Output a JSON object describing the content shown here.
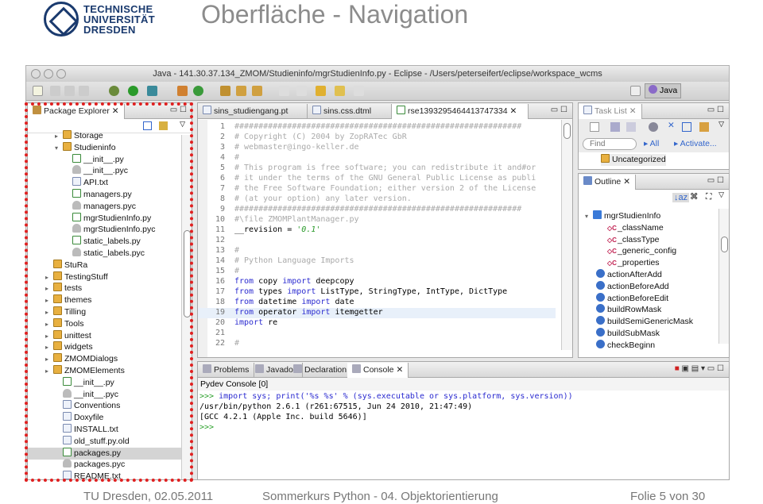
{
  "slide": {
    "title": "Oberfläche - Navigation",
    "logo_text": [
      "TECHNISCHE",
      "UNIVERSITÄT",
      "DRESDEN"
    ],
    "footer": {
      "left": "TU Dresden, 02.05.2011",
      "center": "Sommerkurs Python - 04. Objektorientierung",
      "right": "Folie 5 von 30"
    },
    "highlight_color": "#e02020"
  },
  "window": {
    "title": "Java - 141.30.37.134_ZMOM/Studieninfo/mgrStudienInfo.py - Eclipse - /Users/peterseifert/eclipse/workspace_wcms",
    "perspective": "Java"
  },
  "package_explorer": {
    "tab": "Package Explorer",
    "items": [
      {
        "label": "Storage",
        "type": "folder",
        "level": 1,
        "tri": "▸"
      },
      {
        "label": "Studieninfo",
        "type": "folder",
        "level": 1,
        "tri": "▾"
      },
      {
        "label": "__init__.py",
        "type": "py",
        "level": 2
      },
      {
        "label": "__init__.pyc",
        "type": "pyc",
        "level": 2
      },
      {
        "label": "API.txt",
        "type": "txt",
        "level": 2
      },
      {
        "label": "managers.py",
        "type": "py",
        "level": 2
      },
      {
        "label": "managers.pyc",
        "type": "pyc",
        "level": 2
      },
      {
        "label": "mgrStudienInfo.py",
        "type": "py",
        "level": 2
      },
      {
        "label": "mgrStudienInfo.pyc",
        "type": "pyc",
        "level": 2
      },
      {
        "label": "static_labels.py",
        "type": "py",
        "level": 2
      },
      {
        "label": "static_labels.pyc",
        "type": "pyc",
        "level": 2
      },
      {
        "label": "StuRa",
        "type": "folder",
        "level": 0,
        "tri": ""
      },
      {
        "label": "TestingStuff",
        "type": "folder",
        "level": 0,
        "tri": "▸"
      },
      {
        "label": "tests",
        "type": "folder",
        "level": 0,
        "tri": "▸"
      },
      {
        "label": "themes",
        "type": "folder",
        "level": 0,
        "tri": "▸"
      },
      {
        "label": "Tilling",
        "type": "folder",
        "level": 0,
        "tri": "▸"
      },
      {
        "label": "Tools",
        "type": "folder",
        "level": 0,
        "tri": "▸"
      },
      {
        "label": "unittest",
        "type": "folder",
        "level": 0,
        "tri": "▸"
      },
      {
        "label": "widgets",
        "type": "folder",
        "level": 0,
        "tri": "▸"
      },
      {
        "label": "ZMOMDialogs",
        "type": "folder",
        "level": 0,
        "tri": "▸"
      },
      {
        "label": "ZMOMElements",
        "type": "folder",
        "level": 0,
        "tri": "▸"
      },
      {
        "label": "__init__.py",
        "type": "py",
        "level": 1
      },
      {
        "label": "__init__.pyc",
        "type": "pyc",
        "level": 1
      },
      {
        "label": "Conventions",
        "type": "txt",
        "level": 1
      },
      {
        "label": "Doxyfile",
        "type": "txt",
        "level": 1
      },
      {
        "label": "INSTALL.txt",
        "type": "txt",
        "level": 1
      },
      {
        "label": "old_stuff.py.old",
        "type": "txt",
        "level": 1
      },
      {
        "label": "packages.py",
        "type": "py",
        "level": 1,
        "selected": true
      },
      {
        "label": "packages.pyc",
        "type": "pyc",
        "level": 1
      },
      {
        "label": "README.txt",
        "type": "txt",
        "level": 1
      }
    ]
  },
  "editor": {
    "tabs": [
      "sins_studiengang.pt",
      "sins.css.dtml",
      "rse1393295464413747334"
    ],
    "active_tab": 2,
    "lines": [
      {
        "n": "1",
        "html": "<span class='cm'>############################################################</span>"
      },
      {
        "n": "2",
        "html": "<span class='cm'>#    Copyright (C) 2004 by ZopRATec GbR</span>"
      },
      {
        "n": "3",
        "html": "<span class='cm'>#    webmaster@ingo-keller.de</span>"
      },
      {
        "n": "4",
        "html": "<span class='cm'>#</span>"
      },
      {
        "n": "5",
        "html": "<span class='cm'>#    This program is free software; you can redistribute it and#or</span>"
      },
      {
        "n": "6",
        "html": "<span class='cm'>#    it under the terms of the GNU General Public License as publi</span>"
      },
      {
        "n": "7",
        "html": "<span class='cm'>#    the Free Software Foundation; either version 2 of the License</span>"
      },
      {
        "n": "8",
        "html": "<span class='cm'>#    (at your option) any later version.</span>"
      },
      {
        "n": "9",
        "html": "<span class='cm'>############################################################</span>"
      },
      {
        "n": "10",
        "html": "<span class='cm'>#\\file ZMOMPlantManager.py</span>"
      },
      {
        "n": "11",
        "html": "__revision = <span class='st'>'0.1'</span>"
      },
      {
        "n": "12",
        "html": ""
      },
      {
        "n": "13",
        "html": "<span class='cm'>#</span>"
      },
      {
        "n": "14",
        "html": "<span class='cm'># Python Language Imports</span>"
      },
      {
        "n": "15",
        "html": "<span class='cm'>#</span>"
      },
      {
        "n": "16",
        "html": "<span class='kw'>from</span> copy <span class='kw'>import</span> deepcopy"
      },
      {
        "n": "17",
        "html": "<span class='kw'>from</span> types   <span class='kw'>import</span> ListType, StringType, IntType, DictType"
      },
      {
        "n": "18",
        "html": "<span class='kw'>from</span> datetime <span class='kw'>import</span> date"
      },
      {
        "n": "19",
        "html": "<span class='kw'>from</span> operator <span class='kw'>import</span> itemgetter"
      },
      {
        "n": "20",
        "html": "<span class='kw'>import</span> re"
      },
      {
        "n": "21",
        "html": ""
      },
      {
        "n": "22",
        "html": "<span class='cm'>#</span>"
      }
    ],
    "current_line": "19"
  },
  "task_list": {
    "tab": "Task List",
    "find_placeholder": "Find",
    "all": "All",
    "activate": "Activate...",
    "category": "Uncategorized"
  },
  "outline": {
    "tab": "Outline",
    "root": "mgrStudienInfo",
    "attributes": [
      "_className",
      "_classType",
      "_generic_config",
      "_properties"
    ],
    "methods": [
      "actionAfterAdd",
      "actionBeforeAdd",
      "actionBeforeEdit",
      "buildRowMask",
      "buildSemiGenericMask",
      "buildSubMask",
      "checkBeginn"
    ]
  },
  "console": {
    "tabs": [
      "Problems",
      "Javadoc",
      "Declaration",
      "Console"
    ],
    "active_tab": 3,
    "header": "Pydev Console [0]",
    "lines": [
      {
        "html": "<span style='color:#2aa02a'>&gt;&gt;&gt;</span> <span class='kw'>import sys; print('%s %s' % (sys.executable or sys.platform, sys.version))</span>"
      },
      {
        "html": "/usr/bin/python 2.6.1 (r261:67515, Jun 24 2010, 21:47:49)"
      },
      {
        "html": "[GCC 4.2.1 (Apple Inc. build 5646)]"
      },
      {
        "html": "<span style='color:#2aa02a'>&gt;&gt;&gt;</span>"
      }
    ]
  }
}
